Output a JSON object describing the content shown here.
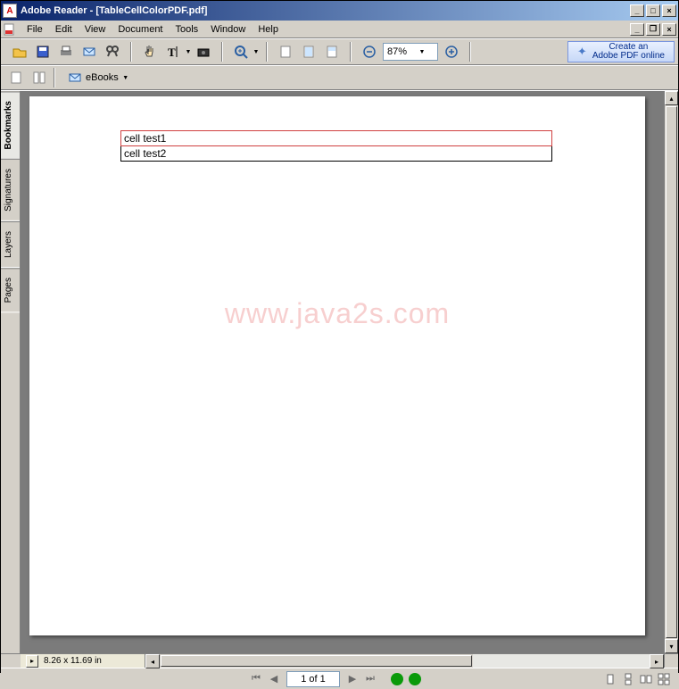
{
  "title": "Adobe Reader - [TableCellColorPDF.pdf]",
  "menu": [
    "File",
    "Edit",
    "View",
    "Document",
    "Tools",
    "Window",
    "Help"
  ],
  "toolbar": {
    "zoom_value": "87%",
    "create_pdf_line1": "Create an",
    "create_pdf_line2": "Adobe PDF online"
  },
  "ebooks_label": "eBooks",
  "side_tabs": [
    "Bookmarks",
    "Signatures",
    "Layers",
    "Pages"
  ],
  "document": {
    "cells": [
      "cell test1",
      "cell test2"
    ],
    "watermark": "www.java2s.com"
  },
  "status": {
    "dimensions": "8.26 x 11.69 in",
    "page_field": "1 of 1"
  }
}
